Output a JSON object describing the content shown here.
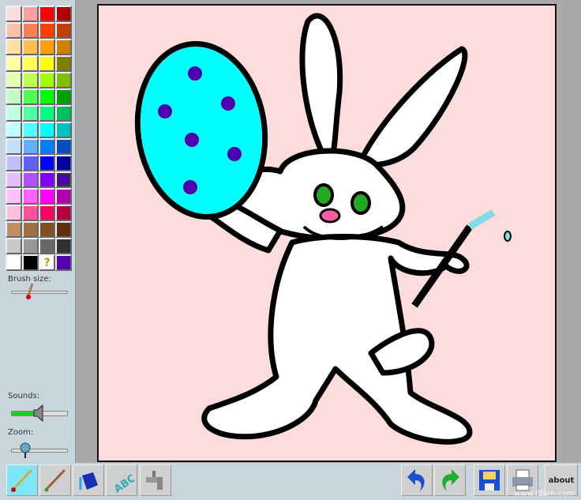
{
  "palette": {
    "colors": [
      "#fddcdc",
      "#ffa0a0",
      "#ff0000",
      "#b00000",
      "#ffc0a8",
      "#ff8050",
      "#ff4000",
      "#c04000",
      "#ffe0a0",
      "#ffc050",
      "#ffa000",
      "#d08000",
      "#ffffa0",
      "#ffff50",
      "#ffff00",
      "#808000",
      "#e8ffb0",
      "#c0ff50",
      "#a0ff00",
      "#80c000",
      "#c0ffc0",
      "#50ff50",
      "#00ff00",
      "#00a000",
      "#c0ffe0",
      "#50ffa0",
      "#00ff80",
      "#00c060",
      "#c0ffff",
      "#50ffff",
      "#00ffff",
      "#00c0c0",
      "#c0e0ff",
      "#60b0ff",
      "#0080ff",
      "#0050c0",
      "#c0c0ff",
      "#6060ff",
      "#0000ff",
      "#0000a0",
      "#e0c0ff",
      "#b050ff",
      "#8000ff",
      "#5000b0",
      "#ffc0ff",
      "#ff60ff",
      "#ff00ff",
      "#b000b0",
      "#ffc0e0",
      "#ff50a0",
      "#ff0060",
      "#b00040",
      "#c09060",
      "#a07040",
      "#805020",
      "#603010",
      "#c8c8c8",
      "#989898",
      "#686868",
      "#303030",
      "#ffffff",
      "#000000"
    ],
    "selected": "#5000b0",
    "random_icon": "question-mark-icon",
    "current_color": "#5000b0"
  },
  "left": {
    "brush_label": "Brush size:",
    "sounds_label": "Sounds:",
    "zoom_label": "Zoom:",
    "brush_size": 0.3,
    "sound_level": 0.5,
    "zoom_level": 0.25
  },
  "canvas": {
    "background": "#fddcdc",
    "egg": "#00ffff",
    "dots": "#5000b0"
  },
  "toolbar": {
    "tools": [
      "brush-icon",
      "pencil-icon",
      "paint-bucket-icon",
      "text-abc-icon",
      "faucet-icon"
    ],
    "active_tool": "brush-icon",
    "undo": "undo-icon",
    "redo": "redo-icon",
    "save": "save-icon",
    "print": "print-icon",
    "about_label": "about",
    "watermark": "www.fifam.com"
  }
}
